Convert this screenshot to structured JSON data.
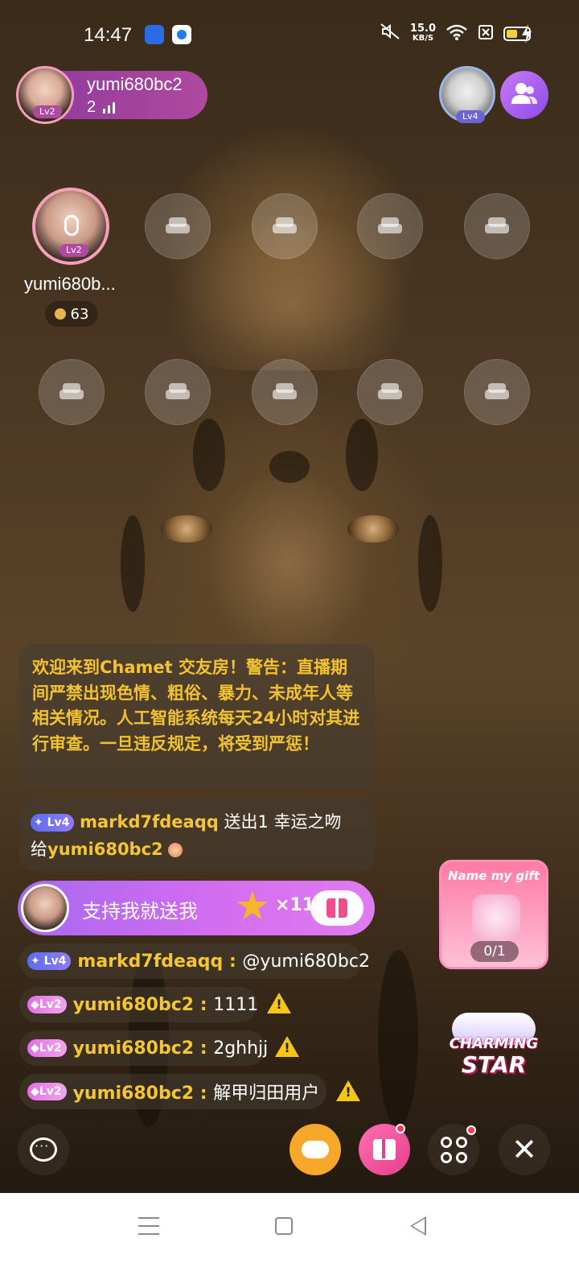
{
  "status_bar": {
    "time": "14:47",
    "net_speed_value": "15.0",
    "net_speed_unit": "KB/S",
    "battery_level": 0.5,
    "icons": [
      "baidu-app-icon",
      "browser-app-icon",
      "mute-icon",
      "wifi-icon",
      "sim-icon",
      "battery-icon",
      "charging-icon"
    ]
  },
  "host": {
    "name": "yumi680bc2",
    "level": "Lv2",
    "online_count": "2"
  },
  "top_right": {
    "badge_level": "Lv4"
  },
  "seats": {
    "main": {
      "name": "yumi680b...",
      "level": "Lv2",
      "coins": "63"
    },
    "empty_icon": "sofa-icon"
  },
  "chat": {
    "notice": "欢迎来到Chamet 交友房！警告：直播期间严禁出现色情、粗俗、暴力、未成年人等相关情况。人工智能系统每天24小时对其进行审查。一旦违反规定，将受到严惩！",
    "gift_message": {
      "level": "Lv4",
      "sender": "markd7fdeaqq",
      "action": " 送出1 幸运之吻",
      "to_prefix": "给",
      "receiver": "yumi680bc2"
    },
    "support": {
      "text": "支持我就送我",
      "count": "×11"
    },
    "messages": [
      {
        "level": "Lv4",
        "user": "markd7fdeaqq",
        "sep": " : ",
        "text": "@yumi680bc2",
        "warn": false
      },
      {
        "level": "Lv2",
        "user": "yumi680bc2",
        "sep": " : ",
        "text": "1111",
        "warn": true
      },
      {
        "level": "Lv2",
        "user": "yumi680bc2",
        "sep": " : ",
        "text": "2ghhjj",
        "warn": true
      },
      {
        "level": "Lv2",
        "user": "yumi680bc2",
        "sep": " : ",
        "text": "解甲归田用户",
        "warn": true
      }
    ]
  },
  "promos": {
    "name_my_gift": {
      "title": "Name my gift",
      "progress": "0/1"
    },
    "charming_star": {
      "line1": "CHARMING",
      "line2": "STAR"
    }
  },
  "toolbar": {
    "close_glyph": "✕",
    "warn_glyph": "!"
  },
  "colors": {
    "accent_purple": "#b04aa0",
    "username_gold": "#f4c534",
    "notice_gold": "#f2c230",
    "gift_pink": "#e43f8d",
    "game_orange": "#f7a72a"
  }
}
